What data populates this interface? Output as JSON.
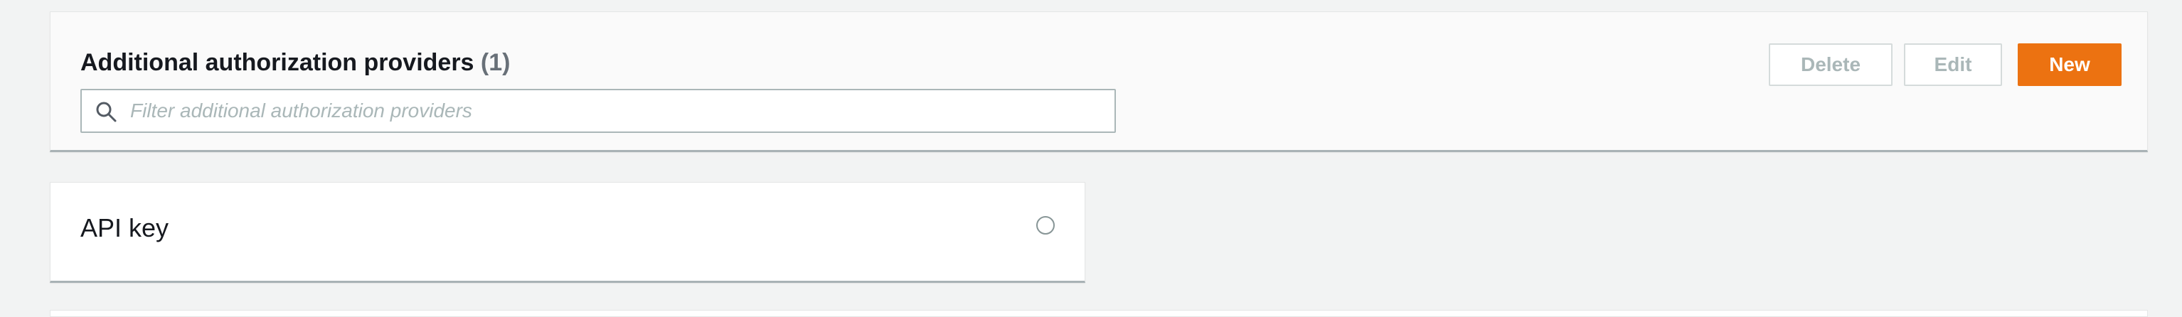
{
  "panel": {
    "title": "Additional authorization providers",
    "count": "(1)",
    "search": {
      "placeholder": "Filter additional authorization providers",
      "value": ""
    },
    "buttons": {
      "delete_label": "Delete",
      "edit_label": "Edit",
      "new_label": "New"
    }
  },
  "providers": [
    {
      "label": "API key",
      "selected": false
    }
  ],
  "colors": {
    "accent": "#ec7211",
    "page_background": "#f2f3f3",
    "panel_background": "#fafafa",
    "disabled_text": "#aab7b8"
  },
  "icons": {
    "search": "search-icon",
    "radio": "radio-unselected"
  }
}
